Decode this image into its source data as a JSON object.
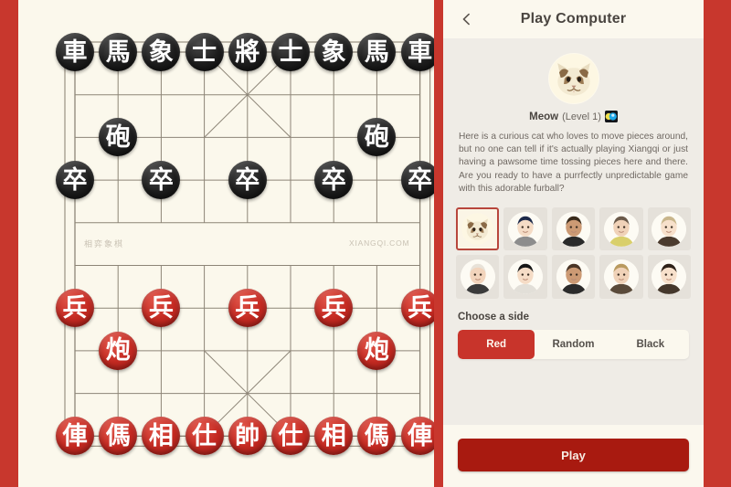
{
  "window": {
    "frame_color": "#c8372d",
    "board_bg": "#fbf8ec",
    "panel_bg": "#efece6"
  },
  "board": {
    "watermark_cn": "相弈象棋",
    "watermark_en": "XIANGQI.COM",
    "files": 9,
    "ranks": 10,
    "pieces": [
      {
        "glyph": "車",
        "side": "black",
        "file": 1,
        "rank": 1,
        "name": "black-chariot-left"
      },
      {
        "glyph": "馬",
        "side": "black",
        "file": 2,
        "rank": 1,
        "name": "black-horse-left"
      },
      {
        "glyph": "象",
        "side": "black",
        "file": 3,
        "rank": 1,
        "name": "black-elephant-left"
      },
      {
        "glyph": "士",
        "side": "black",
        "file": 4,
        "rank": 1,
        "name": "black-advisor-left"
      },
      {
        "glyph": "將",
        "side": "black",
        "file": 5,
        "rank": 1,
        "name": "black-general"
      },
      {
        "glyph": "士",
        "side": "black",
        "file": 6,
        "rank": 1,
        "name": "black-advisor-right"
      },
      {
        "glyph": "象",
        "side": "black",
        "file": 7,
        "rank": 1,
        "name": "black-elephant-right"
      },
      {
        "glyph": "馬",
        "side": "black",
        "file": 8,
        "rank": 1,
        "name": "black-horse-right"
      },
      {
        "glyph": "車",
        "side": "black",
        "file": 9,
        "rank": 1,
        "name": "black-chariot-right"
      },
      {
        "glyph": "砲",
        "side": "black",
        "file": 2,
        "rank": 3,
        "name": "black-cannon-left"
      },
      {
        "glyph": "砲",
        "side": "black",
        "file": 8,
        "rank": 3,
        "name": "black-cannon-right"
      },
      {
        "glyph": "卒",
        "side": "black",
        "file": 1,
        "rank": 4,
        "name": "black-soldier-1"
      },
      {
        "glyph": "卒",
        "side": "black",
        "file": 3,
        "rank": 4,
        "name": "black-soldier-2"
      },
      {
        "glyph": "卒",
        "side": "black",
        "file": 5,
        "rank": 4,
        "name": "black-soldier-3"
      },
      {
        "glyph": "卒",
        "side": "black",
        "file": 7,
        "rank": 4,
        "name": "black-soldier-4"
      },
      {
        "glyph": "卒",
        "side": "black",
        "file": 9,
        "rank": 4,
        "name": "black-soldier-5"
      },
      {
        "glyph": "兵",
        "side": "red",
        "file": 1,
        "rank": 7,
        "name": "red-soldier-1"
      },
      {
        "glyph": "兵",
        "side": "red",
        "file": 3,
        "rank": 7,
        "name": "red-soldier-2"
      },
      {
        "glyph": "兵",
        "side": "red",
        "file": 5,
        "rank": 7,
        "name": "red-soldier-3"
      },
      {
        "glyph": "兵",
        "side": "red",
        "file": 7,
        "rank": 7,
        "name": "red-soldier-4"
      },
      {
        "glyph": "兵",
        "side": "red",
        "file": 9,
        "rank": 7,
        "name": "red-soldier-5"
      },
      {
        "glyph": "炮",
        "side": "red",
        "file": 2,
        "rank": 8,
        "name": "red-cannon-left"
      },
      {
        "glyph": "炮",
        "side": "red",
        "file": 8,
        "rank": 8,
        "name": "red-cannon-right"
      },
      {
        "glyph": "俥",
        "side": "red",
        "file": 1,
        "rank": 10,
        "name": "red-chariot-left"
      },
      {
        "glyph": "傌",
        "side": "red",
        "file": 2,
        "rank": 10,
        "name": "red-horse-left"
      },
      {
        "glyph": "相",
        "side": "red",
        "file": 3,
        "rank": 10,
        "name": "red-elephant-left"
      },
      {
        "glyph": "仕",
        "side": "red",
        "file": 4,
        "rank": 10,
        "name": "red-advisor-left"
      },
      {
        "glyph": "帥",
        "side": "red",
        "file": 5,
        "rank": 10,
        "name": "red-general"
      },
      {
        "glyph": "仕",
        "side": "red",
        "file": 6,
        "rank": 10,
        "name": "red-advisor-right"
      },
      {
        "glyph": "相",
        "side": "red",
        "file": 7,
        "rank": 10,
        "name": "red-elephant-right"
      },
      {
        "glyph": "傌",
        "side": "red",
        "file": 8,
        "rank": 10,
        "name": "red-horse-right"
      },
      {
        "glyph": "俥",
        "side": "red",
        "file": 9,
        "rank": 10,
        "name": "red-chariot-right"
      }
    ]
  },
  "panel": {
    "back_icon": "arrow-left-icon",
    "title": "Play Computer",
    "opponent": {
      "avatar_icon": "cat-avatar",
      "name": "Meow",
      "level": "(Level 1)",
      "badge_icon": "difficulty-badge-icon",
      "description": "Here is a curious cat who loves to move pieces around, but no one can tell if it's actually playing Xiangqi or just having a pawsome time tossing pieces here and there. Are you ready to have a purrfectly unpredictable game with this adorable furball?"
    },
    "avatars": [
      {
        "name": "avatar-cat",
        "icon": "cat-avatar",
        "selected": true
      },
      {
        "name": "avatar-boy-dark-hair",
        "icon": "person-avatar",
        "selected": false
      },
      {
        "name": "avatar-woman-hijab",
        "icon": "person-avatar",
        "selected": false
      },
      {
        "name": "avatar-man-short-hair",
        "icon": "person-avatar",
        "selected": false
      },
      {
        "name": "avatar-man-grey-hair",
        "icon": "person-avatar",
        "selected": false
      },
      {
        "name": "avatar-older-man-glasses",
        "icon": "person-avatar",
        "selected": false
      },
      {
        "name": "avatar-man-glasses-dark",
        "icon": "person-avatar",
        "selected": false
      },
      {
        "name": "avatar-woman-long-hair",
        "icon": "person-avatar",
        "selected": false
      },
      {
        "name": "avatar-blond-man",
        "icon": "person-avatar",
        "selected": false
      },
      {
        "name": "avatar-man-suit",
        "icon": "person-avatar",
        "selected": false
      }
    ],
    "side_section": {
      "label": "Choose a side",
      "options": [
        {
          "label": "Red",
          "active": true
        },
        {
          "label": "Random",
          "active": false
        },
        {
          "label": "Black",
          "active": false
        }
      ]
    },
    "play_label": "Play"
  }
}
